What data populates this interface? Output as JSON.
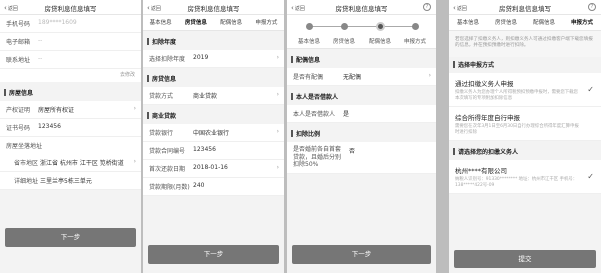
{
  "screen1": {
    "back": "返回",
    "title": "房贷利息信息填写",
    "contact": [
      {
        "label": "手机号码",
        "value": "189****1609",
        "muted": true
      },
      {
        "label": "电子邮箱",
        "value": "--",
        "muted": true
      },
      {
        "label": "联系地址",
        "value": "--",
        "muted": true
      }
    ],
    "edit_link": "去修改",
    "house_section": "房屋信息",
    "house_rows": [
      {
        "label": "产权证明",
        "value": "房屋所有权证"
      },
      {
        "label": "证书号码",
        "value": "123456"
      }
    ],
    "address_label": "房屋坐落地址",
    "address_rows": [
      {
        "label": "省市地区",
        "value": "浙江省 杭州市 江干区 笕桥街道"
      },
      {
        "label": "详细地址",
        "value": "三里兰亭5栋三单元"
      }
    ],
    "next_button": "下一步"
  },
  "screen2": {
    "back": "返回",
    "title": "房贷利息信息填写",
    "tabs": [
      "基本信息",
      "房贷信息",
      "配偶信息",
      "申报方式"
    ],
    "year_section": "扣除年度",
    "year_row": {
      "label": "选择扣除年度",
      "value": "2019"
    },
    "loan_section": "房贷信息",
    "loan_type_row": {
      "label": "贷款方式",
      "value": "商业贷款"
    },
    "biz_section": "商业贷款",
    "biz_rows": [
      {
        "label": "贷款银行",
        "value": "中国农业银行"
      },
      {
        "label": "贷款合同编号",
        "value": "123456"
      },
      {
        "label": "首次还款日期",
        "value": "2018-01-16"
      },
      {
        "label": "贷款期限(月数)",
        "value": "240"
      }
    ],
    "next_button": "下一步"
  },
  "screen3": {
    "back": "返回",
    "title": "房贷利息信息填写",
    "steps": [
      "基本信息",
      "房贷信息",
      "配偶信息",
      "申报方式"
    ],
    "current_step": 2,
    "spouse_section": "配偶信息",
    "spouse_row": {
      "label": "是否有配偶",
      "value": "无配偶"
    },
    "borrower_section": "本人是否借款人",
    "borrower_row": {
      "label": "本人是否借款人",
      "value": "是"
    },
    "ratio_section": "扣除比例",
    "ratio_row": {
      "label": "是否婚前各自首套贷款，且婚后分别扣除50%",
      "value": "否"
    },
    "next_button": "下一步"
  },
  "screen4": {
    "back": "返回",
    "title": "房贷利息信息填写",
    "tabs": [
      "基本信息",
      "房贷信息",
      "配偶信息",
      "申报方式"
    ],
    "notice": "若您选择了扣缴义务人，则扣缴义务人可通过扣缴客户端下载您填报的信息，并在预扣预缴时进行扣除。",
    "method_section": "选择申报方式",
    "options": [
      {
        "title": "通过扣缴义务人申报",
        "desc": "扣缴义务人为您办理个人所得税预扣预缴申报时，需要您下载您本次填写的专项附加扣除信息",
        "checked": true
      },
      {
        "title": "综合所得年度自行申报",
        "desc": "需要您在次年3月1日至6月30日自行办理综合所得年度汇算申报时进行扣除",
        "checked": false
      }
    ],
    "employer_section": "请选择您的扣缴义务人",
    "employer": {
      "name": "杭州****有限公司",
      "detail": "纳税人识别号：91330********  地址：杭州市江干区  手机号：138*****422号-09",
      "checked": true
    },
    "submit_button": "提交"
  }
}
